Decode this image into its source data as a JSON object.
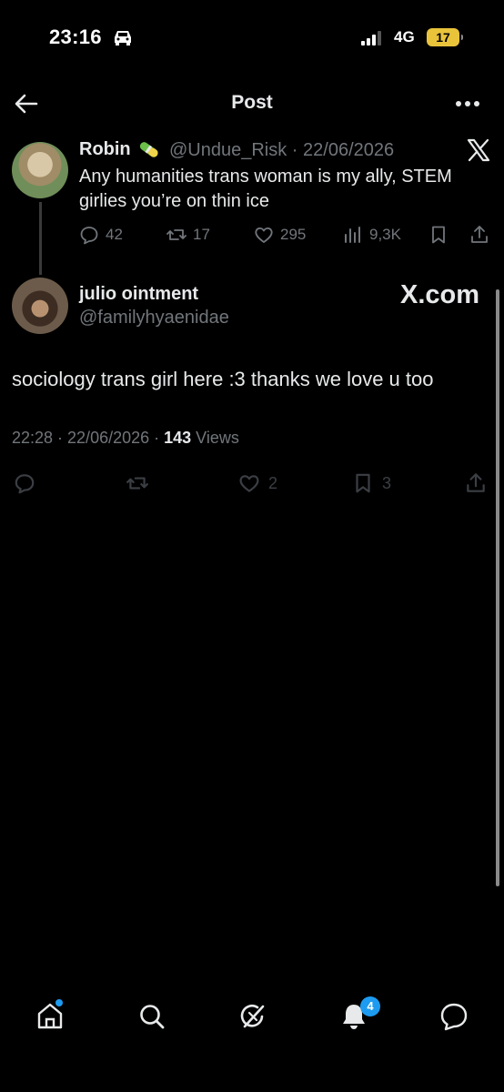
{
  "status_bar": {
    "time": "23:16",
    "network": "4G",
    "battery": "17"
  },
  "header": {
    "title": "Post"
  },
  "quoted_post": {
    "author_name": "Robin",
    "handle_date": "@Undue_Risk · 22/06/2026",
    "text": "Any humanities trans woman is my ally, STEM girlies you’re on thin ice",
    "stats": {
      "replies": "42",
      "reposts": "17",
      "likes": "295",
      "views": "9,3K"
    }
  },
  "main_post": {
    "author_name": "julio ointment",
    "handle": "@familyhyaenidae",
    "watermark": "X.com",
    "text": "sociology trans girl here :3 thanks we love u too",
    "meta_prefix": "22:28 · 22/06/2026 · ",
    "views_count": "143",
    "views_label": " Views",
    "stats": {
      "likes": "2",
      "bookmarks": "3"
    }
  },
  "bottom_nav": {
    "notifications_badge": "4"
  },
  "icons": [
    "car-icon",
    "signal-icon",
    "back-arrow-icon",
    "more-icon",
    "x-logo-icon",
    "reply-icon",
    "repost-icon",
    "like-icon",
    "views-icon",
    "bookmark-icon",
    "share-icon",
    "home-icon",
    "search-icon",
    "grok-icon",
    "bell-icon",
    "messages-icon"
  ],
  "colors": {
    "background": "#000000",
    "text": "#e7e9ea",
    "muted": "#71767b",
    "accent": "#1d9bf0",
    "battery": "#e9c43b"
  }
}
